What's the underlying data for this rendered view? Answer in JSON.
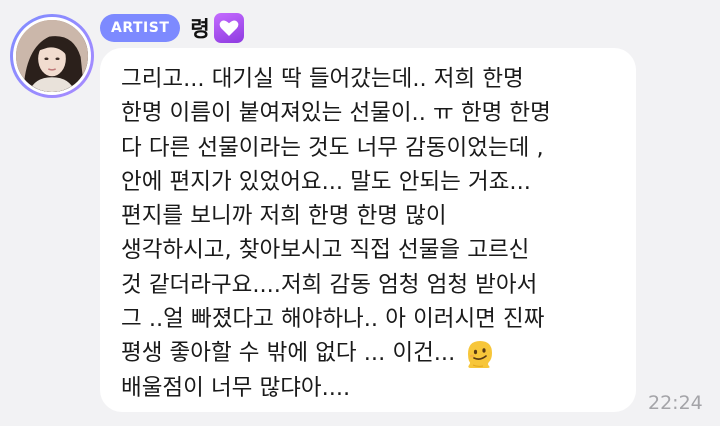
{
  "header": {
    "badge": "ARTIST",
    "sender_name": "령"
  },
  "message": {
    "lines": [
      "그리고... 대기실 딱 들어갔는데.. 저희 한명",
      "한명 이름이 붙여져있는 선물이.. ㅠ 한명 한명",
      "다 다른 선물이라는 것도 너무 감동이었는데 ,",
      "안에 편지가 있었어요... 말도 안되는 거죠...",
      "편지를 보니까 저희 한명 한명 많이",
      "생각하시고, 찾아보시고 직접 선물을 고르신",
      "것 같더라구요....저희 감동 엄청 엄청 받아서",
      "그 ..얼 빠졌다고 해야하나.. 아 이러시면 진짜",
      "평생 좋아할 수 밖에 없다 ... 이건...",
      "배울점이 너무 많댜아...."
    ],
    "timestamp": "22:24",
    "emoji": "melting-face"
  },
  "colors": {
    "background": "#f2f2f4",
    "badge": "#7d8aff",
    "heart_box": "#a64ff0",
    "bubble": "#ffffff",
    "timestamp": "#a4a4a8"
  }
}
